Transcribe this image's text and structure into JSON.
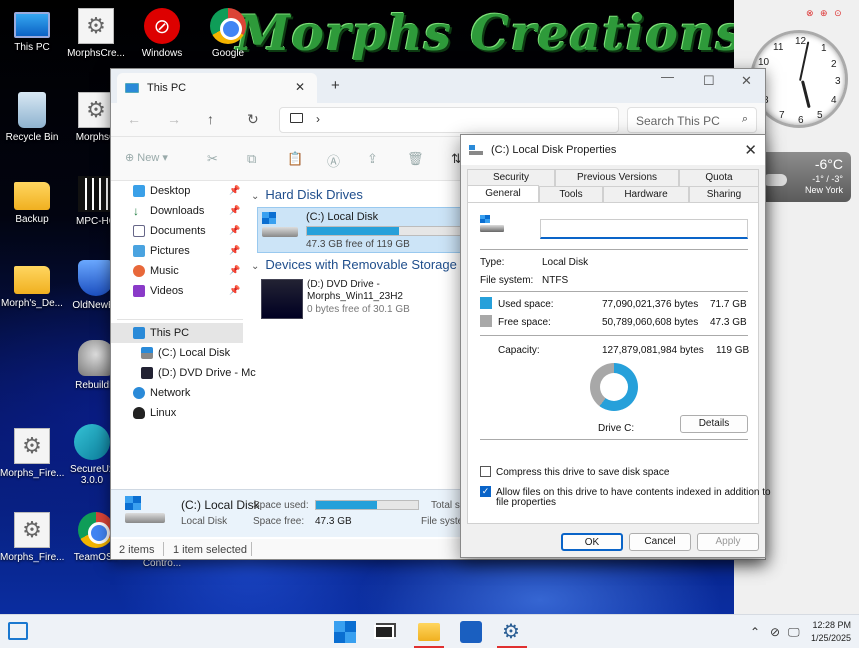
{
  "desktop": {
    "banner": "Morphs Creations",
    "icons": [
      {
        "label": "This PC"
      },
      {
        "label": "MorphsCre..."
      },
      {
        "label": "Windows"
      },
      {
        "label": "Google"
      },
      {
        "label": "Recycle Bin"
      },
      {
        "label": "MorphsC"
      },
      {
        "label": "Backup"
      },
      {
        "label": "MPC-HC"
      },
      {
        "label": "Morph's_De..."
      },
      {
        "label": "OldNewEx"
      },
      {
        "label": "RebuildIc"
      },
      {
        "label": "Morphs_Fire..."
      },
      {
        "label": "SecureUx",
        "sub": "3.0.0"
      },
      {
        "label": "Morphs_Fire..."
      },
      {
        "label": "TeamOS.."
      },
      {
        "label": "Contro..."
      }
    ]
  },
  "clock_widget": {
    "numbers": [
      "12",
      "1",
      "2",
      "3",
      "4",
      "5",
      "6",
      "7",
      "8",
      "9",
      "10",
      "11"
    ]
  },
  "weather": {
    "temp": "-6°C",
    "range": "-1° / -3°",
    "city": "New York"
  },
  "explorer": {
    "tab_title": "This PC",
    "search_placeholder": "Search This PC",
    "new_label": "New",
    "sidebar": {
      "quick": [
        "Desktop",
        "Downloads",
        "Documents",
        "Pictures",
        "Music",
        "Videos"
      ],
      "this_pc": "This PC",
      "local_disk": "(C:) Local Disk",
      "dvd_drive": "(D:) DVD Drive - Mc",
      "network": "Network",
      "linux": "Linux"
    },
    "hard_disk_heading": "Hard Disk Drives",
    "local_disk": {
      "name": "(C:) Local Disk",
      "free_text": "47.3 GB free of 119 GB",
      "used_fraction": 0.6
    },
    "removable_heading": "Devices with Removable Storage",
    "dvd": {
      "line1": "(D:) DVD Drive -",
      "line2": "Morphs_Win11_23H2",
      "free_text": "0 bytes free of 30.1 GB"
    },
    "details": {
      "name": "(C:) Local Disk",
      "type": "Local Disk",
      "space_used_label": "Space used:",
      "space_free_label": "Space free:",
      "space_free": "47.3 GB",
      "total_label": "Total si",
      "fs_label": "File syste"
    },
    "status": {
      "items": "2 items",
      "selected": "1 item selected"
    }
  },
  "properties": {
    "title": "(C:) Local Disk Properties",
    "tabs_top": [
      "Security",
      "Previous Versions",
      "Quota"
    ],
    "tabs_bottom": [
      "General",
      "Tools",
      "Hardware",
      "Sharing"
    ],
    "name_value": "",
    "type_label": "Type:",
    "type_value": "Local Disk",
    "fs_label": "File system:",
    "fs_value": "NTFS",
    "used_label": "Used space:",
    "used_bytes": "77,090,021,376 bytes",
    "used_gb": "71.7 GB",
    "free_label": "Free space:",
    "free_bytes": "50,789,060,608 bytes",
    "free_gb": "47.3 GB",
    "capacity_label": "Capacity:",
    "capacity_bytes": "127,879,081,984 bytes",
    "capacity_gb": "119 GB",
    "used_fraction": 0.603,
    "drive_label": "Drive C:",
    "details_button": "Details",
    "compress_label": "Compress this drive to save disk space",
    "index_label_1": "Allow files on this drive to have contents indexed in addition to",
    "index_label_2": "file properties",
    "ok": "OK",
    "cancel": "Cancel",
    "apply": "Apply",
    "used_color": "#26a0da",
    "free_color": "#a8a8a8"
  },
  "taskbar": {
    "time": "12:28 PM",
    "date": "1/25/2025"
  }
}
